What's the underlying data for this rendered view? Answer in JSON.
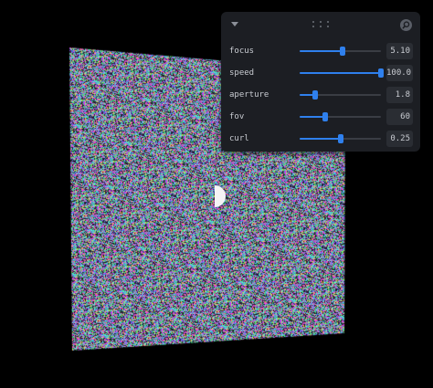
{
  "panel": {
    "header": {
      "collapse_icon": "chevron-down-icon",
      "drag_icon": "drag-dots-icon",
      "search_icon": "search-icon"
    },
    "controls": [
      {
        "id": "focus",
        "label": "focus",
        "value": "5.10",
        "fraction": 0.53
      },
      {
        "id": "speed",
        "label": "speed",
        "value": "100.0",
        "fraction": 1.0
      },
      {
        "id": "aperture",
        "label": "aperture",
        "value": "1.8",
        "fraction": 0.19
      },
      {
        "id": "fov",
        "label": "fov",
        "value": "60",
        "fraction": 0.32
      },
      {
        "id": "curl",
        "label": "curl",
        "value": "0.25",
        "fraction": 0.5
      }
    ]
  },
  "colors": {
    "background": "#000000",
    "panel": "#1c1e23",
    "accent": "#2f80ed",
    "value_box": "#2a2d33",
    "text": "#c9ccd2"
  }
}
